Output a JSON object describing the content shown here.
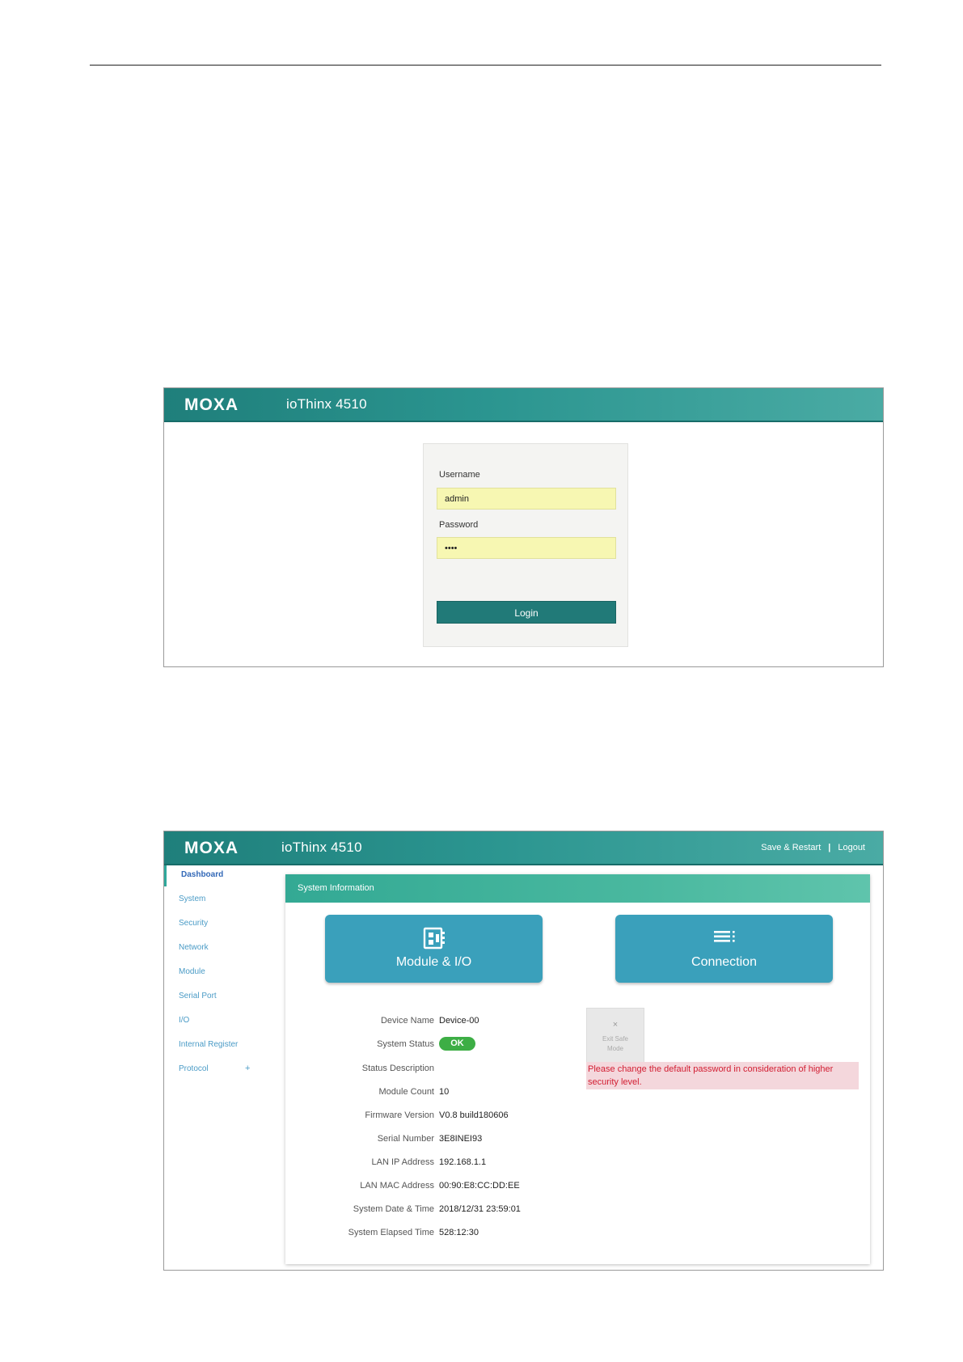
{
  "brand": {
    "logo_text": "MOXA",
    "product": "ioThinx 4510"
  },
  "login": {
    "username_label": "Username",
    "username_value": "admin",
    "password_label": "Password",
    "password_value": "••••",
    "login_button": "Login",
    "input_bg_color": "#f7f7b2",
    "button_color": "#217a78"
  },
  "dashboard": {
    "header_links": {
      "save_restart": "Save & Restart",
      "separator": "|",
      "logout": "Logout"
    },
    "sidebar": {
      "items": [
        {
          "label": "Dashboard",
          "active": true
        },
        {
          "label": "System"
        },
        {
          "label": "Security"
        },
        {
          "label": "Network"
        },
        {
          "label": "Module"
        },
        {
          "label": "Serial Port"
        },
        {
          "label": "I/O"
        },
        {
          "label": "Internal Register"
        },
        {
          "label": "Protocol",
          "expand_icon": "+"
        }
      ]
    },
    "panel_title": "System Information",
    "tiles": [
      {
        "label": "Module & I/O",
        "icon": "module-icon"
      },
      {
        "label": "Connection",
        "icon": "list-icon"
      }
    ],
    "info": {
      "device_name": {
        "label": "Device Name",
        "value": "Device-00"
      },
      "system_status": {
        "label": "System Status",
        "value": "OK"
      },
      "status_description": {
        "label": "Status Description",
        "value": ""
      },
      "module_count": {
        "label": "Module Count",
        "value": "10"
      },
      "firmware_version": {
        "label": "Firmware Version",
        "value": "V0.8 build180606"
      },
      "serial_number": {
        "label": "Serial Number",
        "value": "3E8INEI93"
      },
      "lan_ip": {
        "label": "LAN IP Address",
        "value": "192.168.1.1"
      },
      "lan_mac": {
        "label": "LAN MAC Address",
        "value": "00:90:E8:CC:DD:EE"
      },
      "date_time": {
        "label": "System Date & Time",
        "value": "2018/12/31 23:59:01"
      },
      "elapsed": {
        "label": "System Elapsed Time",
        "value": "528:12:30"
      }
    },
    "safe_mode": {
      "close": "×",
      "line1": "Exit Safe",
      "line2": "Mode"
    },
    "warning": "Please change the default password in consideration of higher security level.",
    "colors": {
      "header": "#2b9590",
      "tile": "#3aa0bb",
      "ok": "#3dae45",
      "warning_text": "#d21e32",
      "warning_bg": "#f4d7dc"
    }
  }
}
